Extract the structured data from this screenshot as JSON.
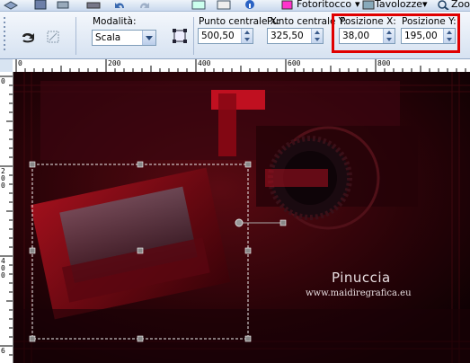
{
  "toolbar_top": {
    "menu_fotoritocco": "Fotoritocco",
    "menu_tavolozze": "Tavolozze",
    "menu_zoom": "Zoo"
  },
  "toolbar": {
    "modalita_label": "Modalità:",
    "modalita_value": "Scala",
    "punto_x_label": "Punto centrale X:",
    "punto_x_value": "500,50",
    "punto_y_label": "Punto centrale Y:",
    "punto_y_value": "325,50",
    "posizione_x_label": "Posizione X:",
    "posizione_x_value": "38,00",
    "posizione_y_label": "Posizione Y:",
    "posizione_y_value": "195,00"
  },
  "ruler_h": [
    "0",
    "200",
    "400",
    "600",
    "800"
  ],
  "ruler_v": [
    "0",
    "2",
    "0",
    "0",
    "4",
    "0",
    "0",
    "6"
  ],
  "watermark": {
    "name": "Pinuccia",
    "site": "www.maidiregrafica.eu"
  }
}
